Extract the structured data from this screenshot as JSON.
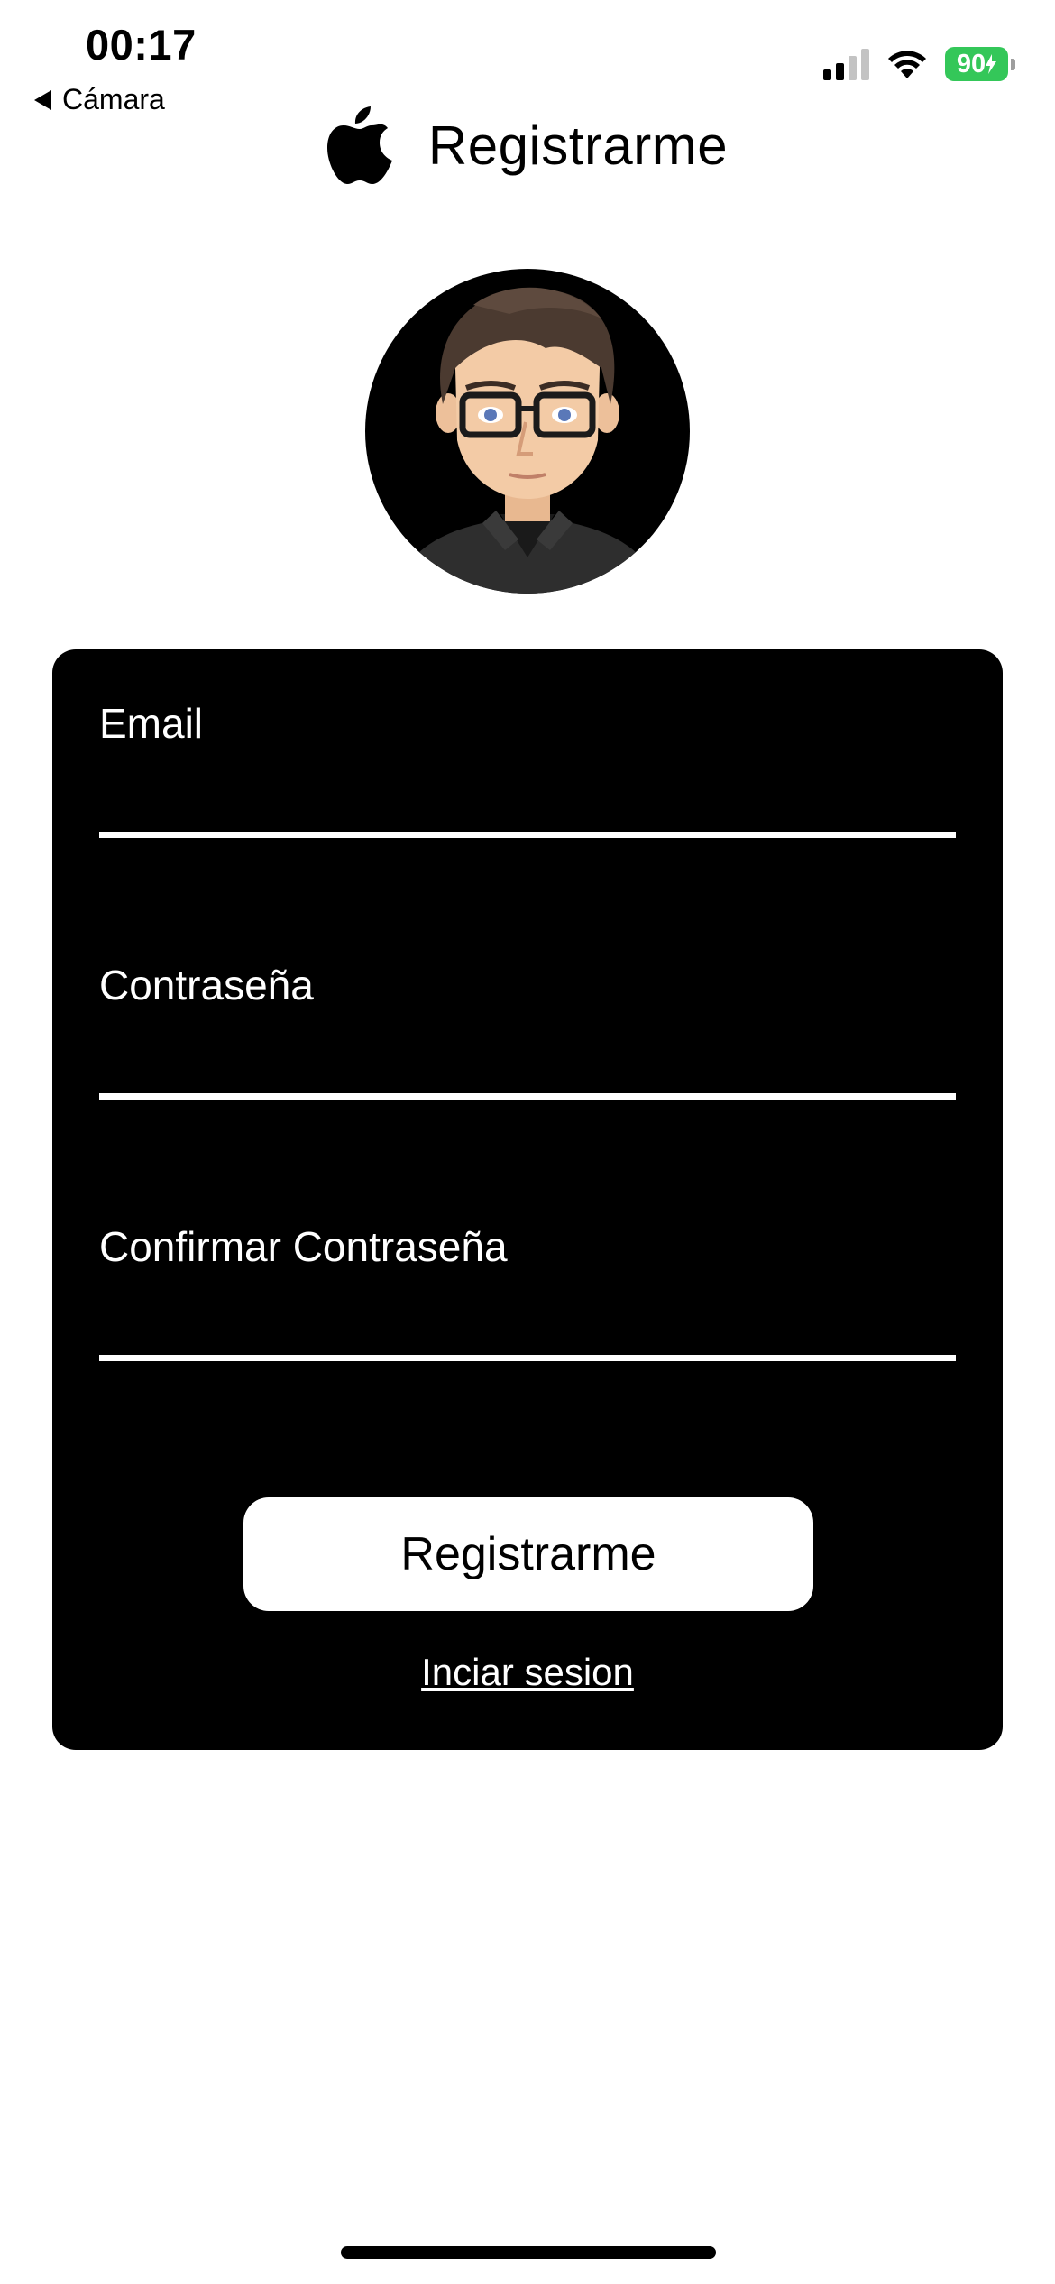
{
  "status_bar": {
    "time": "00:17",
    "back_label": "Cámara",
    "battery": "90"
  },
  "header": {
    "title": "Registrarme"
  },
  "form": {
    "email_label": "Email",
    "password_label": "Contraseña",
    "confirm_password_label": "Confirmar Contraseña",
    "register_button": "Registrarme",
    "login_link": "Inciar sesion"
  },
  "colors": {
    "card": "#000000",
    "battery": "#34c759"
  }
}
